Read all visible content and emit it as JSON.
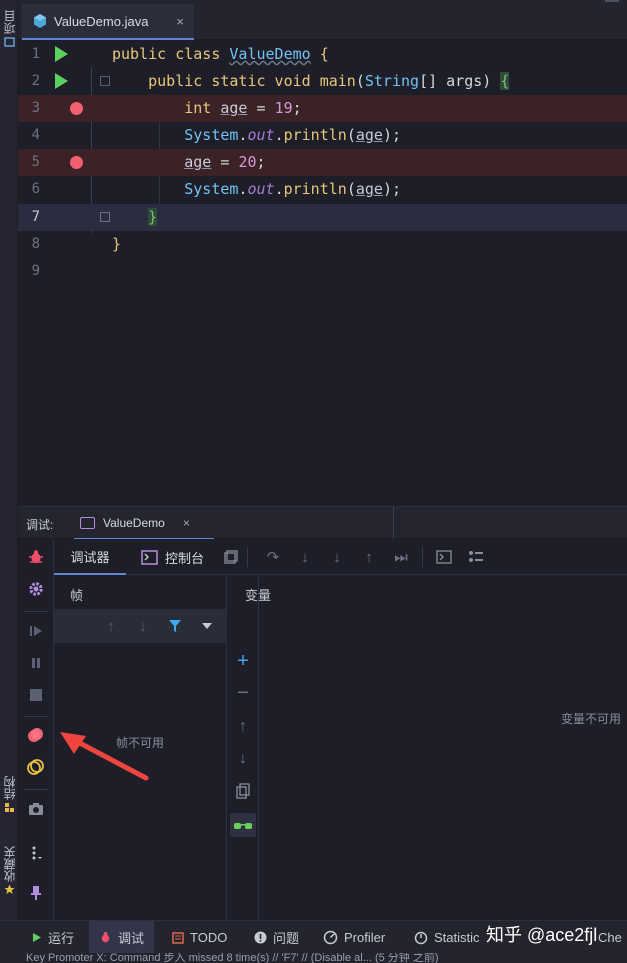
{
  "left_strip": {
    "project_label": "项目",
    "structure_label": "结构",
    "favorites_label": "收藏夹"
  },
  "editor": {
    "tab_title": "ValueDemo.java",
    "tab_close": "×",
    "line_numbers": [
      "1",
      "2",
      "3",
      "4",
      "5",
      "6",
      "7",
      "8",
      "9"
    ],
    "breakpoint_lines": [
      3,
      5
    ],
    "current_line": 7
  },
  "debug": {
    "header_label": "调试:",
    "session_tab": "ValueDemo",
    "session_close": "×",
    "tab_debugger": "调试器",
    "tab_console": "控制台",
    "frames_title": "帧",
    "frames_empty": "帧不可用",
    "variables_title": "变量",
    "variables_empty": "变量不可用"
  },
  "bottom_bar": {
    "run": "运行",
    "debug": "调试",
    "todo": "TODO",
    "problems": "问题",
    "profiler": "Profiler",
    "statistic": "Statistic",
    "trailing": "Che"
  },
  "status_text": "Key Promoter X: Command 步入 missed 8 time(s) // 'F7' // (Disable al... (5 分钟 之前)",
  "watermark": "知乎 @ace2fjl",
  "colors": {
    "accent": "#5f86d6",
    "breakpoint": "#f25f6f",
    "run_green": "#5fd05f",
    "arrow_red": "#f0453e"
  }
}
